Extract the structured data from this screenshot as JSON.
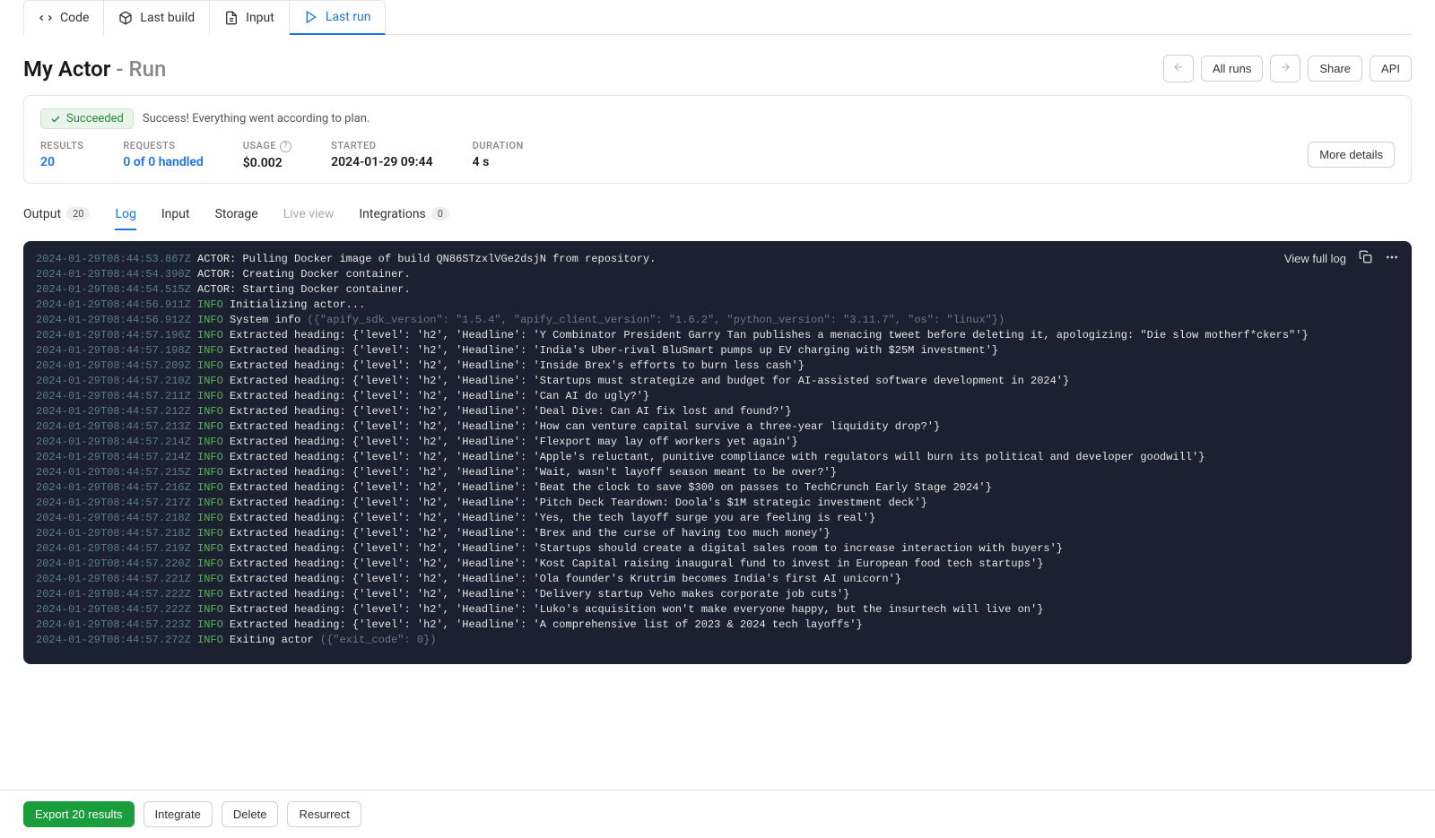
{
  "top_tabs": [
    {
      "key": "code",
      "label": "Code"
    },
    {
      "key": "last-build",
      "label": "Last build"
    },
    {
      "key": "input",
      "label": "Input"
    },
    {
      "key": "last-run",
      "label": "Last run",
      "active": true
    }
  ],
  "title": {
    "main": "My Actor",
    "sub": "Run"
  },
  "actions": {
    "all_runs": "All runs",
    "share": "Share",
    "api": "API"
  },
  "status": {
    "badge": "Succeeded",
    "message": "Success! Everything went according to plan."
  },
  "stats": {
    "results": {
      "label": "RESULTS",
      "value": "20"
    },
    "requests": {
      "label": "REQUESTS",
      "value": "0 of 0 handled"
    },
    "usage": {
      "label": "USAGE",
      "value": "$0.002"
    },
    "started": {
      "label": "STARTED",
      "value": "2024-01-29 09:44"
    },
    "duration": {
      "label": "DURATION",
      "value": "4 s"
    }
  },
  "more_details": "More details",
  "sub_tabs": {
    "output": "Output",
    "output_count": "20",
    "log": "Log",
    "input": "Input",
    "storage": "Storage",
    "live_view": "Live view",
    "integrations": "Integrations",
    "integrations_count": "0"
  },
  "log_toolbar": {
    "view_full": "View full log"
  },
  "log": [
    {
      "ts": "2024-01-29T08:44:53.867Z",
      "level": "",
      "msg": "ACTOR: Pulling Docker image of build QN86STzxlVGe2dsjN from repository."
    },
    {
      "ts": "2024-01-29T08:44:54.390Z",
      "level": "",
      "msg": "ACTOR: Creating Docker container."
    },
    {
      "ts": "2024-01-29T08:44:54.515Z",
      "level": "",
      "msg": "ACTOR: Starting Docker container."
    },
    {
      "ts": "2024-01-29T08:44:56.911Z",
      "level": "INFO",
      "msg": " Initializing actor..."
    },
    {
      "ts": "2024-01-29T08:44:56.912Z",
      "level": "INFO",
      "msg": " System info",
      "dim": " ({\"apify_sdk_version\": \"1.5.4\", \"apify_client_version\": \"1.6.2\", \"python_version\": \"3.11.7\", \"os\": \"linux\"})"
    },
    {
      "ts": "2024-01-29T08:44:57.196Z",
      "level": "INFO",
      "msg": " Extracted heading: {'level': 'h2', 'Headline': 'Y Combinator President Garry Tan publishes a menacing tweet before deleting it, apologizing: \"Die slow motherf*ckers\"'}"
    },
    {
      "ts": "2024-01-29T08:44:57.198Z",
      "level": "INFO",
      "msg": " Extracted heading: {'level': 'h2', 'Headline': 'India's Uber-rival BluSmart pumps up EV charging with $25M investment'}"
    },
    {
      "ts": "2024-01-29T08:44:57.209Z",
      "level": "INFO",
      "msg": " Extracted heading: {'level': 'h2', 'Headline': 'Inside Brex's efforts to burn less cash'}"
    },
    {
      "ts": "2024-01-29T08:44:57.210Z",
      "level": "INFO",
      "msg": " Extracted heading: {'level': 'h2', 'Headline': 'Startups must strategize and budget for AI-assisted software development in 2024'}"
    },
    {
      "ts": "2024-01-29T08:44:57.211Z",
      "level": "INFO",
      "msg": " Extracted heading: {'level': 'h2', 'Headline': 'Can AI do ugly?'}"
    },
    {
      "ts": "2024-01-29T08:44:57.212Z",
      "level": "INFO",
      "msg": " Extracted heading: {'level': 'h2', 'Headline': 'Deal Dive: Can AI fix lost and found?'}"
    },
    {
      "ts": "2024-01-29T08:44:57.213Z",
      "level": "INFO",
      "msg": " Extracted heading: {'level': 'h2', 'Headline': 'How can venture capital survive a three-year liquidity drop?'}"
    },
    {
      "ts": "2024-01-29T08:44:57.214Z",
      "level": "INFO",
      "msg": " Extracted heading: {'level': 'h2', 'Headline': 'Flexport may lay off workers yet again'}"
    },
    {
      "ts": "2024-01-29T08:44:57.214Z",
      "level": "INFO",
      "msg": " Extracted heading: {'level': 'h2', 'Headline': 'Apple's reluctant, punitive compliance with regulators will burn its political and developer goodwill'}"
    },
    {
      "ts": "2024-01-29T08:44:57.215Z",
      "level": "INFO",
      "msg": " Extracted heading: {'level': 'h2', 'Headline': 'Wait, wasn't layoff season meant to be over?'}"
    },
    {
      "ts": "2024-01-29T08:44:57.216Z",
      "level": "INFO",
      "msg": " Extracted heading: {'level': 'h2', 'Headline': 'Beat the clock to save $300 on passes to TechCrunch Early Stage 2024'}"
    },
    {
      "ts": "2024-01-29T08:44:57.217Z",
      "level": "INFO",
      "msg": " Extracted heading: {'level': 'h2', 'Headline': 'Pitch Deck Teardown: Doola's $1M strategic investment deck'}"
    },
    {
      "ts": "2024-01-29T08:44:57.218Z",
      "level": "INFO",
      "msg": " Extracted heading: {'level': 'h2', 'Headline': 'Yes, the tech layoff surge you are feeling is real'}"
    },
    {
      "ts": "2024-01-29T08:44:57.218Z",
      "level": "INFO",
      "msg": " Extracted heading: {'level': 'h2', 'Headline': 'Brex and the curse of having too much money'}"
    },
    {
      "ts": "2024-01-29T08:44:57.219Z",
      "level": "INFO",
      "msg": " Extracted heading: {'level': 'h2', 'Headline': 'Startups should create a digital sales room to increase interaction with buyers'}"
    },
    {
      "ts": "2024-01-29T08:44:57.220Z",
      "level": "INFO",
      "msg": " Extracted heading: {'level': 'h2', 'Headline': 'Kost Capital raising inaugural fund to invest in European food tech startups'}"
    },
    {
      "ts": "2024-01-29T08:44:57.221Z",
      "level": "INFO",
      "msg": " Extracted heading: {'level': 'h2', 'Headline': 'Ola founder's Krutrim becomes India's first AI unicorn'}"
    },
    {
      "ts": "2024-01-29T08:44:57.222Z",
      "level": "INFO",
      "msg": " Extracted heading: {'level': 'h2', 'Headline': 'Delivery startup Veho makes corporate job cuts'}"
    },
    {
      "ts": "2024-01-29T08:44:57.222Z",
      "level": "INFO",
      "msg": " Extracted heading: {'level': 'h2', 'Headline': 'Luko's acquisition won't make everyone happy, but the insurtech will live on'}"
    },
    {
      "ts": "2024-01-29T08:44:57.223Z",
      "level": "INFO",
      "msg": " Extracted heading: {'level': 'h2', 'Headline': 'A comprehensive list of 2023 & 2024 tech layoffs'}"
    },
    {
      "ts": "2024-01-29T08:44:57.272Z",
      "level": "INFO",
      "msg": " Exiting actor",
      "dim": " ({\"exit_code\": 0})"
    }
  ],
  "bottom": {
    "export": "Export 20 results",
    "integrate": "Integrate",
    "delete": "Delete",
    "resurrect": "Resurrect"
  }
}
